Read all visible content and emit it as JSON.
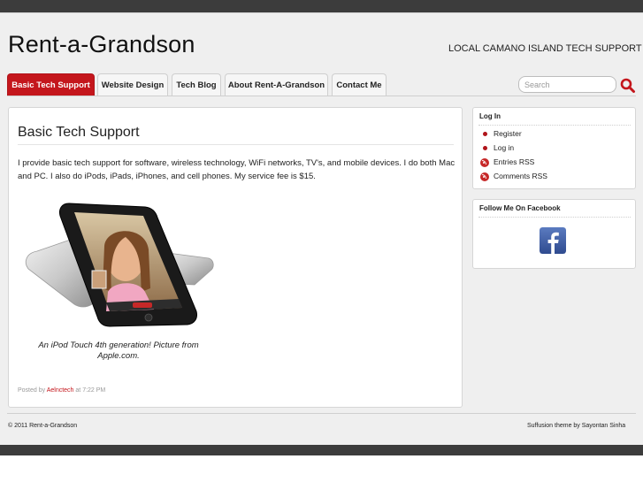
{
  "site": {
    "title": "Rent-a-Grandson",
    "description": "LOCAL CAMANO ISLAND TECH SUPPORT"
  },
  "nav": {
    "tabs": [
      {
        "label": "Basic Tech Support",
        "active": true
      },
      {
        "label": "Website Design",
        "active": false
      },
      {
        "label": "Tech Blog",
        "active": false
      },
      {
        "label": "About Rent-A-Grandson",
        "active": false
      },
      {
        "label": "Contact Me",
        "active": false
      }
    ]
  },
  "search": {
    "placeholder": "Search",
    "value": "",
    "icon": "search-icon"
  },
  "post": {
    "title": "Basic Tech Support",
    "body": "I provide basic tech support for software, wireless technology, WiFi networks, TV's, and mobile devices.  I do both Mac and PC. I also do iPods, iPads, iPhones, and cell phones. My service fee is $15.",
    "image_caption": "An iPod Touch 4th generation! Picture from Apple.com.",
    "meta_prefix": "Posted by",
    "author": "Aelnctech",
    "meta_time": "at 7:22 PM"
  },
  "sidebar": {
    "login_widget": {
      "title": "Log In",
      "items": [
        {
          "label": "Register",
          "icon": "bullet"
        },
        {
          "label": "Log in",
          "icon": "bullet"
        },
        {
          "label": "Entries RSS",
          "icon": "rss-icon"
        },
        {
          "label": "Comments RSS",
          "icon": "rss-icon"
        }
      ]
    },
    "facebook_widget": {
      "title": "Follow Me On Facebook",
      "icon": "facebook-icon"
    }
  },
  "footer": {
    "copyright": "© 2011 Rent-a-Grandson",
    "credit": "Suffusion theme by Sayontan Sinha"
  },
  "colors": {
    "accent": "#c4161c",
    "page_bg": "#efefef",
    "frame": "#3c3c3c"
  }
}
